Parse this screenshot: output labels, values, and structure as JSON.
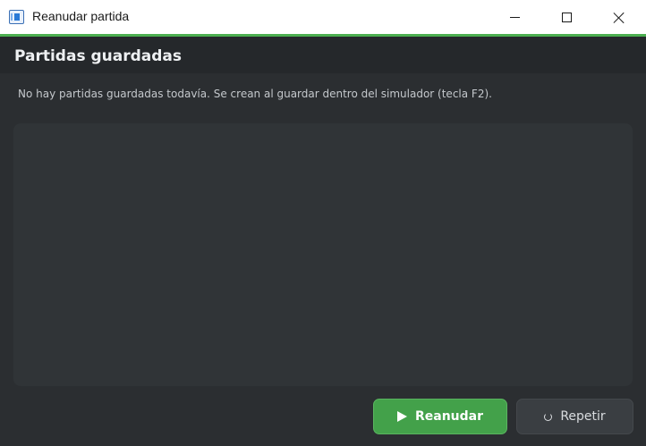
{
  "window": {
    "title": "Reanudar partida",
    "controls": [
      "minimize-icon",
      "maximize-icon",
      "close-icon"
    ]
  },
  "header": {
    "title": "Partidas guardadas"
  },
  "main": {
    "info": "No hay partidas guardadas todavía. Se crean al guardar dentro del simulador (tecla F2).",
    "saves": []
  },
  "actions": {
    "resume_label": "Reanudar",
    "resume_icon": "play-icon",
    "repeat_label": "Repetir",
    "repeat_icon": "refresh-icon"
  },
  "colors": {
    "accent": "#4caf50",
    "background": "#2b2e31",
    "header": "#25282b",
    "resume_button": "#43a14a"
  }
}
